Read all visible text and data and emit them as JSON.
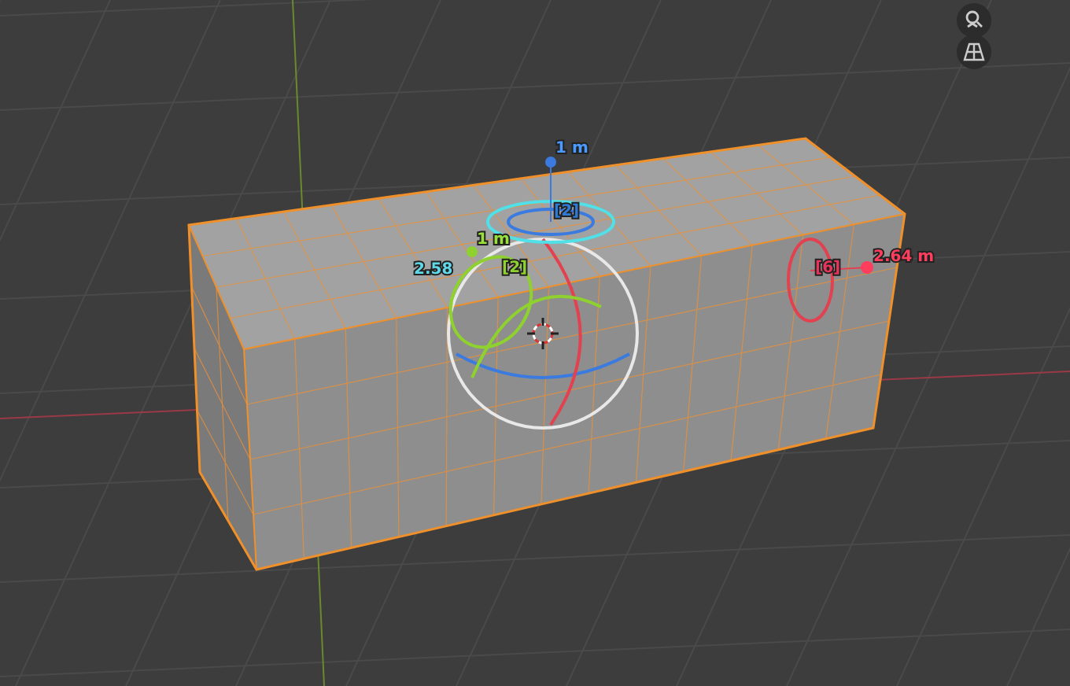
{
  "viewport": {
    "labels": [
      {
        "text": "1 m",
        "color": "#4a9bff"
      },
      {
        "text": "[2]",
        "color": "#2e7bd6"
      },
      {
        "text": "1 m",
        "color": "#9ae03a"
      },
      {
        "text": "2.58",
        "color": "#5fd8e8"
      },
      {
        "text": "[2]",
        "color": "#8fd12e"
      },
      {
        "text": "[6]",
        "color": "#e8345a"
      },
      {
        "text": "2.64 m",
        "color": "#ff3d5c"
      }
    ]
  }
}
